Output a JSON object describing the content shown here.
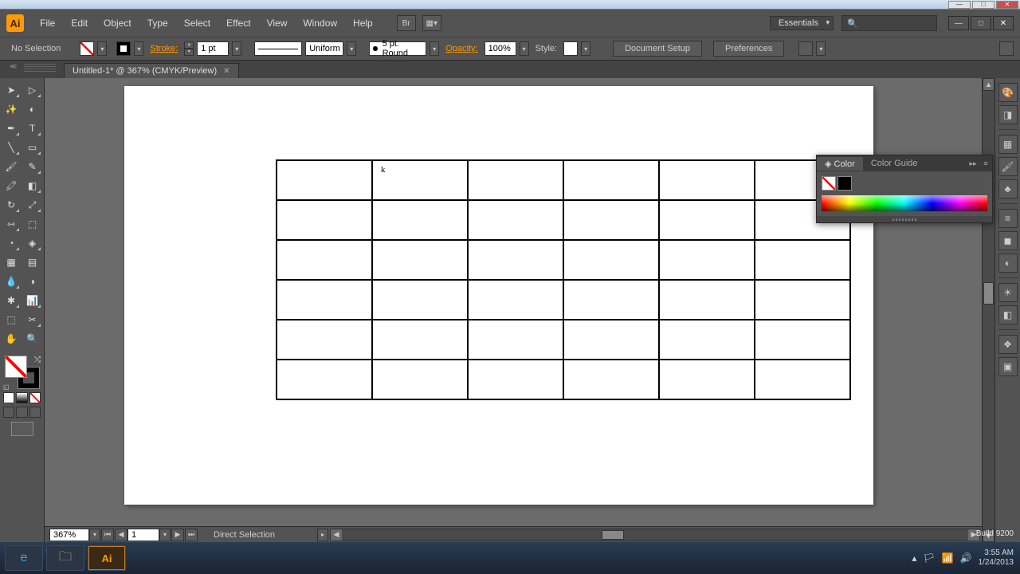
{
  "menubar": {
    "logo": "Ai",
    "items": [
      "File",
      "Edit",
      "Object",
      "Type",
      "Select",
      "Effect",
      "View",
      "Window",
      "Help"
    ],
    "workspace": "Essentials",
    "search_placeholder": ""
  },
  "controlbar": {
    "selection": "No Selection",
    "stroke_label": "Stroke:",
    "stroke_weight": "1 pt",
    "profile": "Uniform",
    "brush": "5 pt. Round",
    "opacity_label": "Opacity:",
    "opacity_value": "100%",
    "style_label": "Style:",
    "doc_setup": "Document Setup",
    "preferences": "Preferences"
  },
  "tab": {
    "title": "Untitled-1* @ 367% (CMYK/Preview)"
  },
  "grid": {
    "rows": 6,
    "cols": 6
  },
  "status": {
    "zoom": "367%",
    "page": "1",
    "tool": "Direct Selection"
  },
  "colorpanel": {
    "tab_color": "Color",
    "tab_guide": "Color Guide"
  },
  "taskbar": {
    "time": "3:55 AM",
    "date": "1/24/2013",
    "build": "Build 9200"
  }
}
